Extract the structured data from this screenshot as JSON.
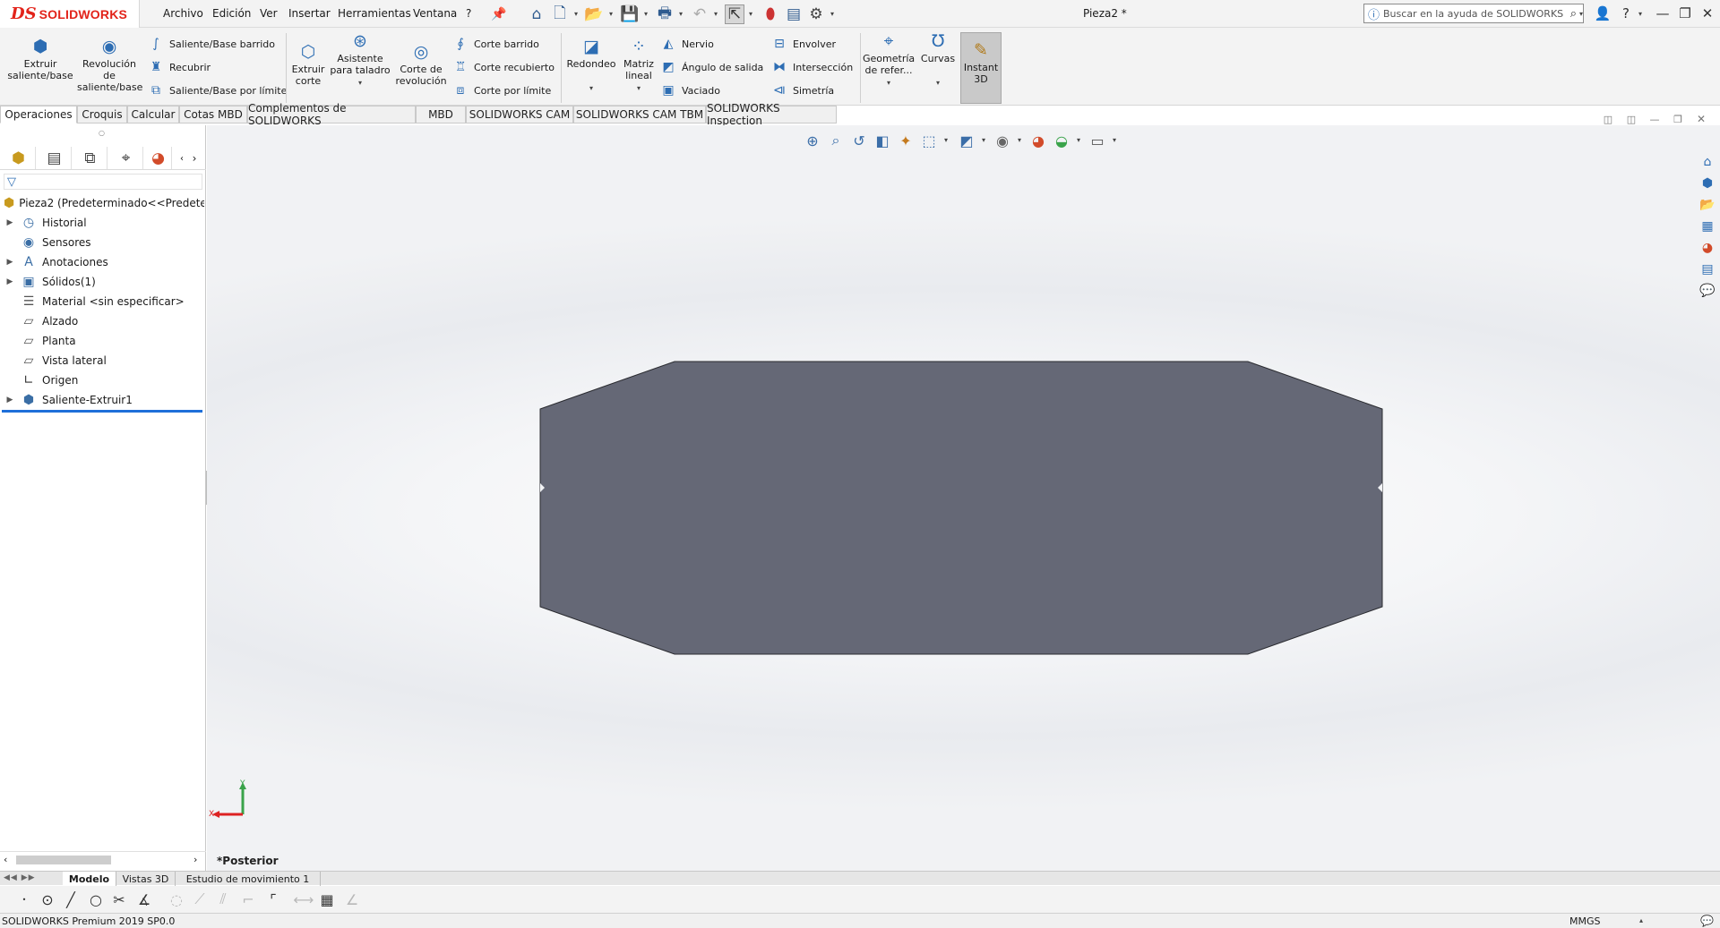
{
  "app": {
    "brand_mark": "DS",
    "brand_name": "SOLIDWORKS"
  },
  "menu": [
    "Archivo",
    "Edición",
    "Ver",
    "Insertar",
    "Herramientas",
    "Ventana",
    "?"
  ],
  "document_title": "Pieza2 *",
  "search": {
    "placeholder": "Buscar en la ayuda de SOLIDWORKS"
  },
  "toolbar_icons": [
    "home-icon",
    "new-document-icon",
    "open-icon",
    "save-icon",
    "print-icon",
    "undo-icon",
    "select-icon",
    "traffic-light-icon",
    "file-properties-icon",
    "options-gear-icon"
  ],
  "ribbon": {
    "extrude_boss": "Extruir saliente/base",
    "revolve_boss_l1": "Revolución",
    "revolve_boss_l2": "de",
    "revolve_boss_l3": "saliente/base",
    "swept_boss": "Saliente/Base barrido",
    "loft": "Recubrir",
    "boundary_boss": "Saliente/Base por límite",
    "extrude_cut": "Extruir corte",
    "hole_wizard": "Asistente para taladro",
    "revolve_cut": "Corte de revolución",
    "swept_cut": "Corte barrido",
    "lofted_cut": "Corte recubierto",
    "boundary_cut": "Corte por límite",
    "fillet": "Redondeo",
    "linear_pattern": "Matriz lineal",
    "rib": "Nervio",
    "draft": "Ángulo de salida",
    "shell": "Vaciado",
    "wrap": "Envolver",
    "intersect": "Intersección",
    "mirror": "Simetría",
    "ref_geometry": "Geometría de refer...",
    "curves": "Curvas",
    "instant3d": "Instant 3D"
  },
  "tabs": [
    {
      "label": "Operaciones",
      "active": true
    },
    {
      "label": "Croquis"
    },
    {
      "label": "Calcular"
    },
    {
      "label": "Cotas MBD"
    },
    {
      "label": "Complementos de SOLIDWORKS"
    },
    {
      "label": "MBD"
    },
    {
      "label": "SOLIDWORKS CAM"
    },
    {
      "label": "SOLIDWORKS CAM TBM"
    },
    {
      "label": "SOLIDWORKS Inspection"
    }
  ],
  "feature_tree": {
    "root": "Pieza2  (Predeterminado<<Predeterm",
    "items": [
      {
        "label": "Historial",
        "expandable": true,
        "icon": "history-icon"
      },
      {
        "label": "Sensores",
        "expandable": false,
        "icon": "sensors-icon"
      },
      {
        "label": "Anotaciones",
        "expandable": true,
        "icon": "annotations-icon"
      },
      {
        "label": "Sólidos(1)",
        "expandable": true,
        "icon": "solid-bodies-icon"
      },
      {
        "label": "Material <sin especificar>",
        "expandable": false,
        "icon": "material-icon"
      },
      {
        "label": "Alzado",
        "expandable": false,
        "icon": "plane-icon"
      },
      {
        "label": "Planta",
        "expandable": false,
        "icon": "plane-icon"
      },
      {
        "label": "Vista lateral",
        "expandable": false,
        "icon": "plane-icon"
      },
      {
        "label": "Origen",
        "expandable": false,
        "icon": "origin-icon"
      },
      {
        "label": "Saliente-Extruir1",
        "expandable": true,
        "icon": "extrude-feature-icon"
      }
    ]
  },
  "viewport": {
    "view_name": "*Posterior",
    "triad_y": "Y",
    "triad_x": "X",
    "model_color": "#656876"
  },
  "bottom_tabs": [
    {
      "label": "Modelo",
      "active": true
    },
    {
      "label": "Vistas 3D"
    },
    {
      "label": "Estudio de movimiento 1"
    }
  ],
  "status": {
    "version": "SOLIDWORKS Premium 2019 SP0.0",
    "units": "MMGS"
  },
  "colors": {
    "brand_red": "#e2231a",
    "accent_blue": "#2d6db3",
    "selection_line": "#1e6fd9"
  }
}
